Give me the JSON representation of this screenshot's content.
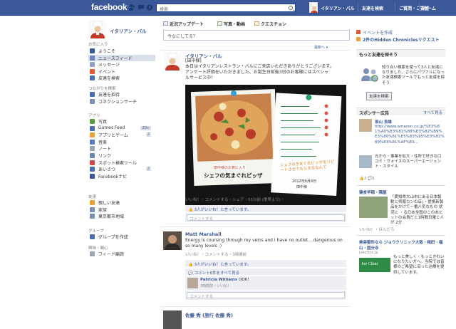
{
  "topbar": {
    "logo": "facebook",
    "search_placeholder": "検索",
    "user_name": "イタリアン・バル",
    "links": [
      "友達を検索",
      "ご質問・ご要望",
      "ホーム"
    ]
  },
  "left": {
    "profile_name": "イタリアン・バル",
    "section_favorites": "お気に入り",
    "favorites": [
      {
        "label": "ようこそ",
        "icon": "welcome-icon",
        "color": "#3b5998"
      },
      {
        "label": "ニュースフィード",
        "icon": "news-feed-icon",
        "color": "#6d84b4"
      },
      {
        "label": "メッセージ",
        "icon": "messages-icon",
        "color": "#8fa2c6"
      },
      {
        "label": "イベント",
        "icon": "events-icon",
        "color": "#e05a3a"
      },
      {
        "label": "友達を検索",
        "icon": "find-friends-icon",
        "color": "#4a6eab"
      }
    ],
    "section_connect": "つながりを検索",
    "connect": [
      {
        "label": "友達を招待",
        "icon": "invite-icon",
        "color": "#4a6eab"
      },
      {
        "label": "コネクションサーチ",
        "icon": "connection-icon",
        "color": "#7b8fb5"
      }
    ],
    "section_apps": "アプリ",
    "apps": [
      {
        "label": "写真",
        "icon": "photos-icon",
        "color": "#5a9e4a",
        "badge": ""
      },
      {
        "label": "Games Feed",
        "icon": "games-icon",
        "color": "#4a6eab",
        "badge": "20+"
      },
      {
        "label": "アプリとゲーム",
        "icon": "apps-icon",
        "color": "#e6a23c",
        "badge": "2"
      },
      {
        "label": "音楽",
        "icon": "music-icon",
        "color": "#5c7cbb",
        "badge": ""
      },
      {
        "label": "ノート",
        "icon": "notes-icon",
        "color": "#9aa5b8",
        "badge": ""
      },
      {
        "label": "リンク",
        "icon": "links-icon",
        "color": "#6d84b4",
        "badge": ""
      },
      {
        "label": "スポット検索ツール",
        "icon": "place-icon",
        "color": "#c94b4b",
        "badge": ""
      },
      {
        "label": "あいさつ",
        "icon": "poke-icon",
        "color": "#4a6eab",
        "badge": "2"
      },
      {
        "label": "Facebookナビ",
        "icon": "navi-icon",
        "color": "#3b5998",
        "badge": ""
      }
    ],
    "section_friends": "友達",
    "friends": [
      {
        "label": "親しい友達",
        "icon": "close-friends-icon",
        "color": "#e6a23c"
      },
      {
        "label": "家族",
        "icon": "family-icon",
        "color": "#7b8fb5"
      },
      {
        "label": "東京都市地域",
        "icon": "location-icon",
        "color": "#7b8fb5"
      }
    ],
    "section_groups": "グループ",
    "groups": [
      {
        "label": "グループを作成",
        "icon": "create-group-icon",
        "color": "#4a6eab"
      }
    ],
    "section_lists": "興味・関心",
    "lists": [
      {
        "label": "フィード編読",
        "icon": "feed-icon",
        "color": "#9aa5b8"
      }
    ]
  },
  "center": {
    "tabs": [
      "近況アップデート",
      "写真・動画",
      "クエスチョン"
    ],
    "status_placeholder": "今なにしてる？",
    "sort_label": "最新へ ▾",
    "post1": {
      "author": "イタリアン・バル",
      "text_lines": [
        "[田中様]",
        "本日はイタリアンレストラン・バルにご来店いただきありがとうございます。",
        "アンケート評価をいただきました。お誕生日前後3日のお客様にはスペシャ",
        "ルサービス中！"
      ],
      "photo_caption": "シェフの気まぐれピッザ",
      "photo_badge": "田中様のお気に入り",
      "card_date": "2012年6月6日",
      "card_name": "田中様",
      "card_handwriting": "シェフのきまぐれピッザをリピートさせてもらえるなんて",
      "meta": "いいね！・コメントする・シェア・55分前 (携帯より)・",
      "likes": "3人がいいね！と言っています。",
      "comment_placeholder": "コメントする"
    },
    "post2": {
      "author": "Matt Marshall",
      "text_lines": [
        "Energy is coursing through my veins and I have no outlet....dangerous on",
        "so many levels :)"
      ],
      "meta": "いいね！・コメントする・3時間前",
      "likes": "3人がいいね！と言っています。",
      "view_comments": "コメント6件をすべて見る",
      "commenter": "Patricia Williams",
      "comment": "OOK!",
      "comment_meta": "3時間前・いいね！",
      "comment_placeholder": "コメントする"
    },
    "post3": {
      "author": "佐藤 秀 (旅行 佐藤 秀)"
    }
  },
  "right": {
    "create_event": "イベントを作成",
    "birthday": "2件のHidden Chroniclesリクエスト",
    "friends_header": "もっと友達を探そう",
    "friends_text": "知り合い検索を使って3人と友達になりました。さらにパワフルになった友達検索ツールでもっと友達を探そう",
    "find_button": "友達を検索",
    "ads_header": "スポンサー広告",
    "ads_more": "すべて見る",
    "ad1_name": "坂山 良雄",
    "ad1_text": "http://www.amazon.co.jp/%E3%81%A0%E3%81%88%E3%82%B9%E3%80%81%E5%83%95%E3%82%89%E3%81%AF%E3...",
    "ad1_desc": "元から・事業を拡大・住所で好きな口コミ・ヴォイスのスーパーエージェント・スタイル",
    "ad1_stats": "👍3  💬1",
    "ad2_title": "健食早稲・隅屋",
    "ad2_text": "「愛知県大山市にある日本製靴と呉服カンの店」・提携新製品をかけて一番人気なもの 状況に ・る日本全国のこの本ヒットの会員だと1時間日曜と人が 2分",
    "ad2_meta": "いいね！・ほんだら",
    "ad3_title": "美容整形なら ジョウクリニック大阪・梅田・福山・国分寺",
    "ad3_url": "joeclinic.jp",
    "ad3_logo": "Joe Clinic",
    "ad3_desc": "もっと美しく・もっときれいになりたい方へ。当院では皆様のご希望に沿った治療を提供しています。"
  }
}
